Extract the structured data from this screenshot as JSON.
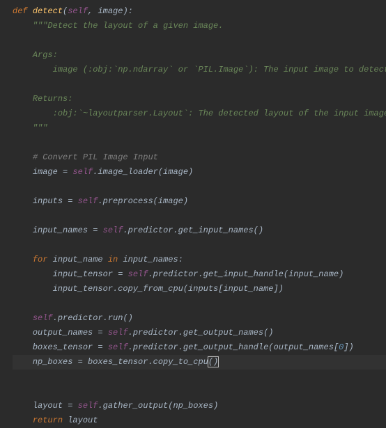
{
  "code": {
    "def": "def ",
    "fn_name": "detect",
    "sig_open": "(",
    "self": "self",
    "comma_sp": ", ",
    "param_image": "image",
    "sig_close": "):",
    "doc_open": "\"\"\"Detect the layout of a given image.",
    "args_hdr": "Args:",
    "args_line": "    image (:obj:`np.ndarray` or `PIL.Image`): The input image to detect.",
    "ret_hdr": "Returns:",
    "ret_line": "    :obj:`~layoutparser.Layout`: The detected layout of the input image",
    "doc_close": "\"\"\"",
    "comment1": "# Convert PIL Image Input",
    "l_image_eq": "image = ",
    "l_dot_image_loader": ".image_loader(image)",
    "l_inputs_eq": "inputs = ",
    "l_dot_preprocess": ".preprocess(image)",
    "l_input_names_eq": "input_names = ",
    "l_dot_pred_getin": ".predictor.get_input_names()",
    "for_kw": "for ",
    "for_var": "input_name ",
    "in_kw": "in ",
    "for_iter": "input_names:",
    "l_tensor_eq": "input_tensor = ",
    "l_dot_pred_handle": ".predictor.get_input_handle(input_name)",
    "l_tensor_copy": "input_tensor.copy_from_cpu(inputs[input_name])",
    "l_dot_pred_run": ".predictor.run()",
    "l_outnames_eq": "output_names = ",
    "l_dot_pred_getout": ".predictor.get_output_names()",
    "l_boxtensor_eq": "boxes_tensor = ",
    "l_dot_pred_outhandle_a": ".predictor.get_output_handle(output_names[",
    "zero": "0",
    "l_dot_pred_outhandle_b": "])",
    "l_npboxes_eq": "np_boxes = boxes_tensor.copy_to_cpu",
    "paren_cursor": "()",
    "l_layout_eq": "layout = ",
    "l_dot_gather": ".gather_output(np_boxes)",
    "return_kw": "return ",
    "return_val": "layout"
  }
}
